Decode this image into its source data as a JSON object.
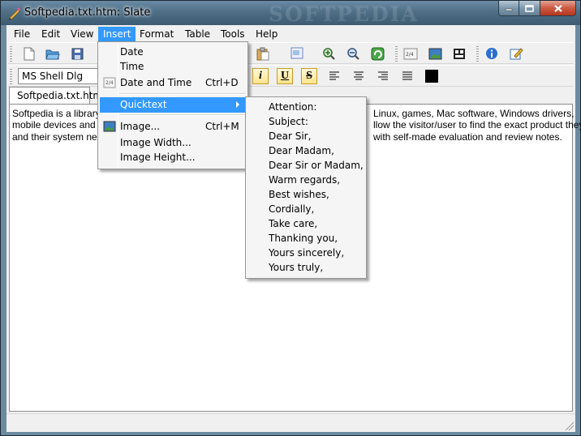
{
  "window": {
    "title": "Softpedia.txt.htm: Slate",
    "watermark": "SOFTPEDIA"
  },
  "menubar": {
    "items": [
      "File",
      "Edit",
      "View",
      "Insert",
      "Format",
      "Table",
      "Tools",
      "Help"
    ],
    "active": "Insert"
  },
  "toolbar": {
    "font_name": "MS Shell Dlg",
    "color_swatch": "#000000"
  },
  "tabs": [
    {
      "label": "Softpedia.txt.htm"
    }
  ],
  "document": {
    "lines": [
      "Softpedia is a library of",
      "mobile devices and IT",
      "and their system needs"
    ],
    "lines_right": [
      "Linux, games, Mac software, Windows drivers,",
      "llow the visitor/user to find the exact product they",
      "with self-made evaluation and review notes."
    ]
  },
  "insert_menu": {
    "items": [
      {
        "label": "Date",
        "accel": ""
      },
      {
        "label": "Time",
        "accel": ""
      },
      {
        "label": "Date and Time",
        "accel": "Ctrl+D",
        "icon": "date-time-icon"
      },
      {
        "label": "Quicktext",
        "accel": "",
        "submenu": true
      },
      {
        "label": "Image...",
        "accel": "Ctrl+M",
        "icon": "image-icon"
      },
      {
        "label": "Image Width...",
        "accel": ""
      },
      {
        "label": "Image Height...",
        "accel": ""
      }
    ]
  },
  "quicktext_menu": {
    "items": [
      "Attention:",
      "Subject:",
      "Dear Sir,",
      "Dear Madam,",
      "Dear Sir or Madam,",
      "Warm regards,",
      "Best wishes,",
      "Cordially,",
      "Take care,",
      "Thanking you,",
      "Yours sincerely,",
      "Yours truly,"
    ]
  },
  "colors": {
    "menu_highlight": "#3399ff",
    "titlebar": "#4f6f87",
    "close_button": "#cc5a42"
  }
}
